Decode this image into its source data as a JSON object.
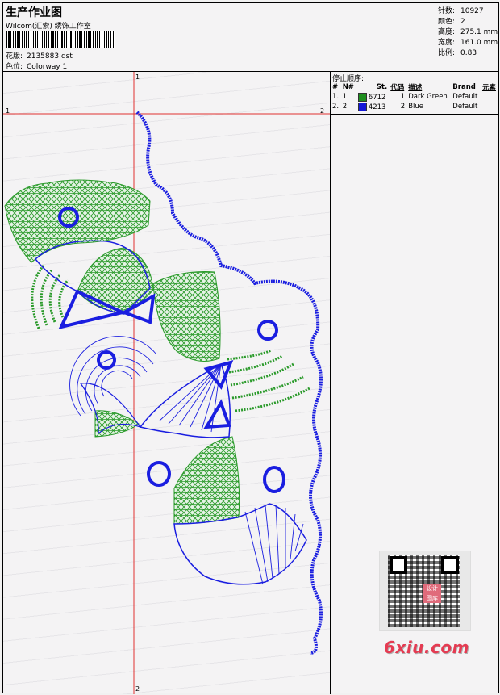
{
  "header": {
    "title": "生产作业图",
    "company": "Wilcom(汇索) 绣饰工作室",
    "design_label": "花版:",
    "design_value": "2135883.dst",
    "colorway_label": "色位:",
    "colorway_value": "Colorway 1"
  },
  "stats": [
    {
      "label": "针数:",
      "value": "10927"
    },
    {
      "label": "颜色:",
      "value": "2"
    },
    {
      "label": "高度:",
      "value": "275.1 mm"
    },
    {
      "label": "宽度:",
      "value": "161.0 mm"
    },
    {
      "label": "比例:",
      "value": "0.83"
    }
  ],
  "stop_sequence": {
    "title": "停止顺序:",
    "columns": [
      "#",
      "N#",
      "St.",
      "代码",
      "描述",
      "Brand",
      "元素"
    ],
    "rows": [
      {
        "num": "1.",
        "n": "1",
        "code": "6712",
        "st": "1",
        "desc": "Dark Green",
        "brand": "Default",
        "color": "#1e8f1e"
      },
      {
        "num": "2.",
        "n": "2",
        "code": "4213",
        "st": "2",
        "desc": "Blue",
        "brand": "Default",
        "color": "#1418d8"
      }
    ]
  },
  "guides": {
    "h_start": "1",
    "h_end": "2",
    "v_start": "1",
    "v_end": "2"
  },
  "colors": {
    "thread_green": "#2a9a2a",
    "thread_blue": "#1a1ee0",
    "guide_red": "#e0302f"
  },
  "watermark": {
    "brand": "6xiu.com",
    "badge": "设计 图库"
  }
}
